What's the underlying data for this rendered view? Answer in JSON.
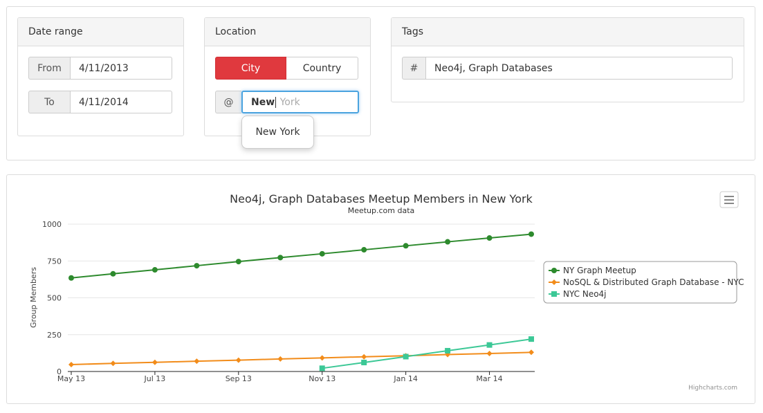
{
  "filters": {
    "date_range": {
      "title": "Date range",
      "from_label": "From",
      "from_value": "4/11/2013",
      "to_label": "To",
      "to_value": "4/11/2014"
    },
    "location": {
      "title": "Location",
      "city_label": "City",
      "country_label": "Country",
      "selected": "City",
      "at_symbol": "@",
      "input_typed": "New",
      "input_hint": " York",
      "suggestion": "New York"
    },
    "tags": {
      "title": "Tags",
      "hash_symbol": "#",
      "value": "Neo4j, Graph Databases"
    }
  },
  "chart": {
    "menu_icon": "hamburger-menu-icon",
    "credits": "Highcharts.com"
  },
  "colors": {
    "accent_red": "#e0393e",
    "focus_blue": "#66afe9",
    "ny_graph": "#2d8a2d",
    "nosql": "#f28c1a",
    "nyc_neo4j": "#3cc896"
  },
  "chart_data": {
    "type": "line",
    "title": "Neo4j, Graph Databases Meetup Members in New York",
    "subtitle": "Meetup.com data",
    "xlabel": "",
    "ylabel": "Group Members",
    "ylim": [
      0,
      1000
    ],
    "yticks": [
      "0",
      "250",
      "500",
      "750",
      "1000"
    ],
    "x": [
      "2013-05",
      "2013-06",
      "2013-07",
      "2013-08",
      "2013-09",
      "2013-10",
      "2013-11",
      "2013-12",
      "2014-01",
      "2014-02",
      "2014-03",
      "2014-04"
    ],
    "xtick_labels": [
      "May 13",
      "Jul 13",
      "Sep 13",
      "Nov 13",
      "Jan 14",
      "Mar 14"
    ],
    "xtick_positions": [
      "2013-05",
      "2013-07",
      "2013-09",
      "2013-11",
      "2014-01",
      "2014-03"
    ],
    "grid": true,
    "legend_position": "right",
    "series": [
      {
        "name": "NY Graph Meetup",
        "color": "#2d8a2d",
        "marker": "circle",
        "values": [
          635,
          663,
          690,
          718,
          746,
          773,
          799,
          826,
          853,
          880,
          906,
          932
        ]
      },
      {
        "name": "NoSQL & Distributed Graph Database - NYC",
        "color": "#f28c1a",
        "marker": "diamond",
        "values": [
          47,
          55,
          62,
          70,
          77,
          85,
          92,
          100,
          107,
          115,
          122,
          130
        ]
      },
      {
        "name": "NYC Neo4j",
        "color": "#3cc896",
        "marker": "square",
        "values": [
          null,
          null,
          null,
          null,
          null,
          null,
          22,
          61,
          101,
          141,
          180,
          220
        ]
      }
    ]
  }
}
